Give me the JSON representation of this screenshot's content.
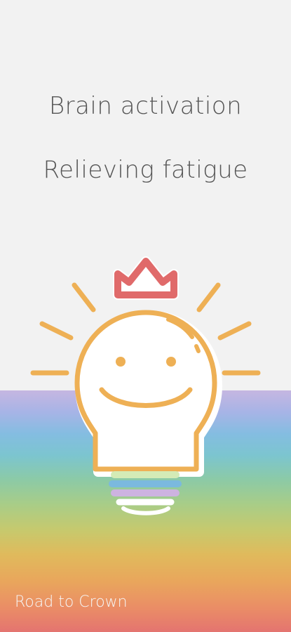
{
  "headlines": {
    "line1": "Brain activation",
    "line2": "Relieving fatigue"
  },
  "footer": {
    "label": "Road to Crown"
  },
  "illustration": {
    "icon": "smiling-lightbulb-with-crown",
    "bulb_color": "#eeb055",
    "crown_color": "#e06a6a"
  },
  "colors": {
    "background_top": "#f2f2f2",
    "rainbow_top": "#c5b6e1",
    "rainbow_bottom": "#e47470",
    "text": "#555555"
  }
}
